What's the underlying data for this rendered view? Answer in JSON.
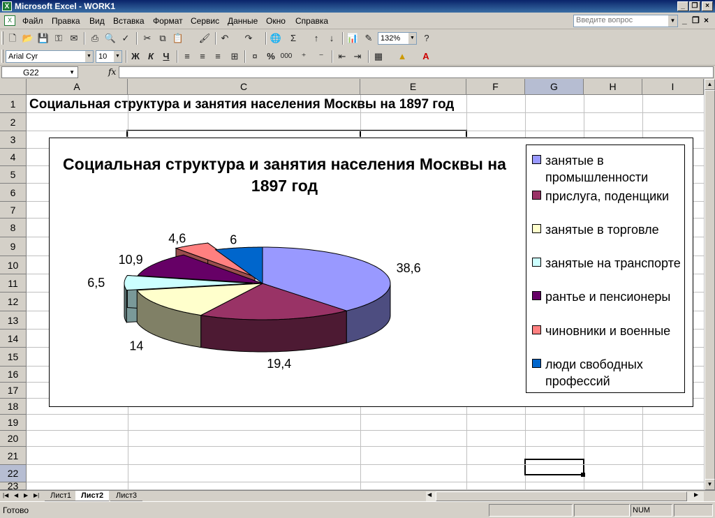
{
  "window": {
    "title": "Microsoft Excel - WORK1"
  },
  "menu": [
    "Файл",
    "Правка",
    "Вид",
    "Вставка",
    "Формат",
    "Сервис",
    "Данные",
    "Окно",
    "Справка"
  ],
  "help_placeholder": "Введите вопрос",
  "toolbar": {
    "zoom": "132%",
    "font": "Arial Cyr",
    "font_size": "10",
    "bold": "Ж",
    "italic": "К",
    "underline": "Ч",
    "percent": "%",
    "thousands": "000"
  },
  "formula_bar": {
    "name_box": "G22",
    "fx": "fx",
    "content": ""
  },
  "columns": [
    "A",
    "C",
    "E",
    "F",
    "G",
    "H",
    "I"
  ],
  "rows": [
    "1",
    "2",
    "3",
    "4",
    "5",
    "6",
    "7",
    "8",
    "9",
    "10",
    "11",
    "12",
    "13",
    "14",
    "15",
    "16",
    "17",
    "18",
    "19",
    "20",
    "21",
    "22",
    "23"
  ],
  "selected_cell": "G22",
  "cells": {
    "A1": "Социальная структура и занятия населения Москвы на 1897 год"
  },
  "sheets": [
    "Лист1",
    "Лист2",
    "Лист3"
  ],
  "active_sheet": "Лист2",
  "status": {
    "ready": "Готово",
    "num": "NUM"
  },
  "chart_data": {
    "type": "pie",
    "title": "Социальная структура и занятия населения Москвы на 1897 год",
    "categories": [
      "занятые в промышленности",
      "прислуга, поденщики",
      "занятые в торговле",
      "занятые на транспорте",
      "рантье и пенсионеры",
      "чиновники и военные",
      "люди свободных профессий"
    ],
    "values": [
      38.6,
      19.4,
      14,
      6.5,
      10.9,
      4.6,
      6
    ],
    "value_labels": [
      "38,6",
      "19,4",
      "14",
      "6,5",
      "10,9",
      "4,6",
      "6"
    ],
    "colors": [
      "#9999ff",
      "#993366",
      "#ffffcc",
      "#ccffff",
      "#660066",
      "#ff8080",
      "#0066cc"
    ],
    "legend": "right",
    "style": "3D exploded"
  }
}
